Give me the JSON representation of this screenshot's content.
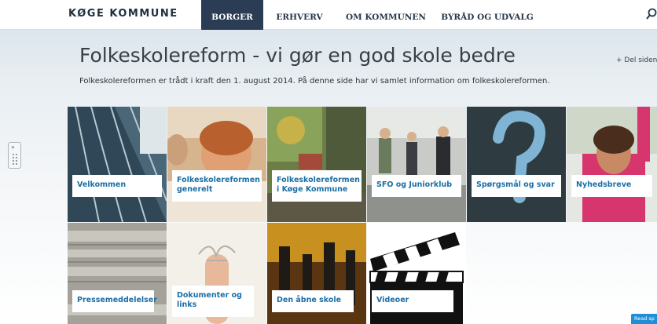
{
  "header": {
    "logo": "KØGE KOMMUNE",
    "nav": [
      {
        "label": "BORGER",
        "active": true
      },
      {
        "label": "ERHVERV",
        "active": false
      },
      {
        "label": "OM KOMMUNEN",
        "active": false
      },
      {
        "label": "BYRÅD OG UDVALG",
        "active": false
      }
    ],
    "search_icon": "search-icon"
  },
  "page": {
    "title": "Folkeskolereform - vi gør en god skole bedre",
    "share": "+ Del siden",
    "intro": "Folkeskolereformen er trådt i kraft den 1. august 2014. På denne side har vi samlet information om folkeskolereformen."
  },
  "tiles": [
    {
      "label": "Velkommen",
      "color": "#3f5a6b"
    },
    {
      "label": "Folkeskolereformen\ngenerelt",
      "color": "#c99a6a"
    },
    {
      "label": "Folkeskolereformen\ni Køge Kommune",
      "color": "#7d8c4a"
    },
    {
      "label": "SFO og Juniorklub",
      "color": "#a6a8a6"
    },
    {
      "label": "Spørgsmål og svar",
      "color": "#2c3a40"
    },
    {
      "label": "Nyhedsbreve",
      "color": "#c9566c"
    },
    {
      "label": "Pressemeddelelser",
      "color": "#9a9891"
    },
    {
      "label": "Dokumenter og\nlinks",
      "color": "#f0e9e2"
    },
    {
      "label": "Den åbne skole",
      "color": "#7a4a1e"
    },
    {
      "label": "Videoer",
      "color": "#111111"
    }
  ],
  "read_button": "Read sp",
  "colors": {
    "nav_active": "#2b3d54",
    "link": "#1a6fa6"
  }
}
